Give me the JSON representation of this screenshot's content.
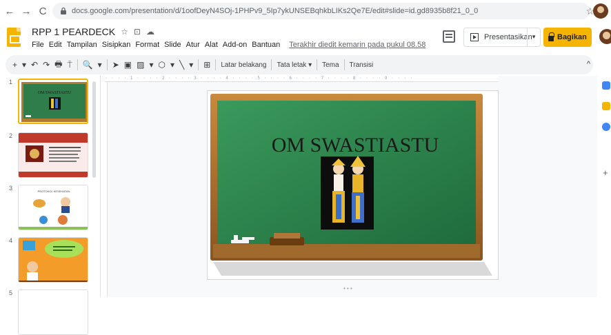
{
  "browser": {
    "back": "←",
    "forward": "→",
    "reload": "C",
    "url": "docs.google.com/presentation/d/1oofDeyN4SOj-1PHPv9_5Ip7ykUNSEBqhkbLIKs2Qe7E/edit#slide=id.gd8935b8f21_0_0",
    "star": "☆"
  },
  "app": {
    "title": "RPP 1 PEARDECK",
    "title_icons": [
      "☆",
      "⊡",
      "☁"
    ],
    "menu": [
      "File",
      "Edit",
      "Tampilan",
      "Sisipkan",
      "Format",
      "Slide",
      "Atur",
      "Alat",
      "Add-on",
      "Bantuan"
    ],
    "last_edit": "Terakhir diedit kemarin pada pukul 08.58",
    "present_label": "Presentasikan",
    "share_label": "Bagikan",
    "accent": "#f4b400"
  },
  "toolbar": {
    "icons": [
      "+",
      "▾",
      "↶",
      "↷",
      "🖶",
      "⍑",
      "🔍",
      "▾",
      "➤",
      "▣",
      "▨",
      "▾",
      "⬡",
      "▾",
      "╲",
      "▾",
      "⊞"
    ],
    "background_label": "Latar belakang",
    "layout_label": "Tata letak ▾",
    "theme_label": "Tema",
    "transition_label": "Transisi",
    "collapse": "^"
  },
  "filmstrip": {
    "slides": [
      {
        "num": "1",
        "title": "OM SWASTIASTU",
        "theme": "chalkboard"
      },
      {
        "num": "2",
        "title": "",
        "theme": "red"
      },
      {
        "num": "3",
        "title": "PROTOKOL KESEHATAN",
        "theme": "white"
      },
      {
        "num": "4",
        "title": "",
        "theme": "orange"
      },
      {
        "num": "5",
        "title": "",
        "theme": "blank"
      }
    ]
  },
  "slide": {
    "title": "OM SWASTIASTU",
    "board_color": "#2e7d4a",
    "frame_color": "#b07a33"
  },
  "ruler": {
    "marks": "· · · · 1 · · · · 2 · · · · 3 · · · · 4 · · · · 5 · · · · 6 · · · · 7 · · · · 8 · · · · 9 · · · ·"
  }
}
